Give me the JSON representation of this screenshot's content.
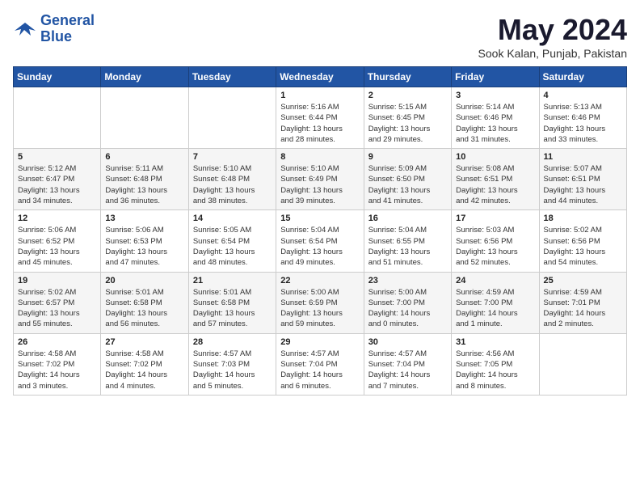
{
  "logo": {
    "line1": "General",
    "line2": "Blue"
  },
  "title": "May 2024",
  "location": "Sook Kalan, Punjab, Pakistan",
  "days_of_week": [
    "Sunday",
    "Monday",
    "Tuesday",
    "Wednesday",
    "Thursday",
    "Friday",
    "Saturday"
  ],
  "weeks": [
    [
      {
        "day": "",
        "content": ""
      },
      {
        "day": "",
        "content": ""
      },
      {
        "day": "",
        "content": ""
      },
      {
        "day": "1",
        "content": "Sunrise: 5:16 AM\nSunset: 6:44 PM\nDaylight: 13 hours\nand 28 minutes."
      },
      {
        "day": "2",
        "content": "Sunrise: 5:15 AM\nSunset: 6:45 PM\nDaylight: 13 hours\nand 29 minutes."
      },
      {
        "day": "3",
        "content": "Sunrise: 5:14 AM\nSunset: 6:46 PM\nDaylight: 13 hours\nand 31 minutes."
      },
      {
        "day": "4",
        "content": "Sunrise: 5:13 AM\nSunset: 6:46 PM\nDaylight: 13 hours\nand 33 minutes."
      }
    ],
    [
      {
        "day": "5",
        "content": "Sunrise: 5:12 AM\nSunset: 6:47 PM\nDaylight: 13 hours\nand 34 minutes."
      },
      {
        "day": "6",
        "content": "Sunrise: 5:11 AM\nSunset: 6:48 PM\nDaylight: 13 hours\nand 36 minutes."
      },
      {
        "day": "7",
        "content": "Sunrise: 5:10 AM\nSunset: 6:48 PM\nDaylight: 13 hours\nand 38 minutes."
      },
      {
        "day": "8",
        "content": "Sunrise: 5:10 AM\nSunset: 6:49 PM\nDaylight: 13 hours\nand 39 minutes."
      },
      {
        "day": "9",
        "content": "Sunrise: 5:09 AM\nSunset: 6:50 PM\nDaylight: 13 hours\nand 41 minutes."
      },
      {
        "day": "10",
        "content": "Sunrise: 5:08 AM\nSunset: 6:51 PM\nDaylight: 13 hours\nand 42 minutes."
      },
      {
        "day": "11",
        "content": "Sunrise: 5:07 AM\nSunset: 6:51 PM\nDaylight: 13 hours\nand 44 minutes."
      }
    ],
    [
      {
        "day": "12",
        "content": "Sunrise: 5:06 AM\nSunset: 6:52 PM\nDaylight: 13 hours\nand 45 minutes."
      },
      {
        "day": "13",
        "content": "Sunrise: 5:06 AM\nSunset: 6:53 PM\nDaylight: 13 hours\nand 47 minutes."
      },
      {
        "day": "14",
        "content": "Sunrise: 5:05 AM\nSunset: 6:54 PM\nDaylight: 13 hours\nand 48 minutes."
      },
      {
        "day": "15",
        "content": "Sunrise: 5:04 AM\nSunset: 6:54 PM\nDaylight: 13 hours\nand 49 minutes."
      },
      {
        "day": "16",
        "content": "Sunrise: 5:04 AM\nSunset: 6:55 PM\nDaylight: 13 hours\nand 51 minutes."
      },
      {
        "day": "17",
        "content": "Sunrise: 5:03 AM\nSunset: 6:56 PM\nDaylight: 13 hours\nand 52 minutes."
      },
      {
        "day": "18",
        "content": "Sunrise: 5:02 AM\nSunset: 6:56 PM\nDaylight: 13 hours\nand 54 minutes."
      }
    ],
    [
      {
        "day": "19",
        "content": "Sunrise: 5:02 AM\nSunset: 6:57 PM\nDaylight: 13 hours\nand 55 minutes."
      },
      {
        "day": "20",
        "content": "Sunrise: 5:01 AM\nSunset: 6:58 PM\nDaylight: 13 hours\nand 56 minutes."
      },
      {
        "day": "21",
        "content": "Sunrise: 5:01 AM\nSunset: 6:58 PM\nDaylight: 13 hours\nand 57 minutes."
      },
      {
        "day": "22",
        "content": "Sunrise: 5:00 AM\nSunset: 6:59 PM\nDaylight: 13 hours\nand 59 minutes."
      },
      {
        "day": "23",
        "content": "Sunrise: 5:00 AM\nSunset: 7:00 PM\nDaylight: 14 hours\nand 0 minutes."
      },
      {
        "day": "24",
        "content": "Sunrise: 4:59 AM\nSunset: 7:00 PM\nDaylight: 14 hours\nand 1 minute."
      },
      {
        "day": "25",
        "content": "Sunrise: 4:59 AM\nSunset: 7:01 PM\nDaylight: 14 hours\nand 2 minutes."
      }
    ],
    [
      {
        "day": "26",
        "content": "Sunrise: 4:58 AM\nSunset: 7:02 PM\nDaylight: 14 hours\nand 3 minutes."
      },
      {
        "day": "27",
        "content": "Sunrise: 4:58 AM\nSunset: 7:02 PM\nDaylight: 14 hours\nand 4 minutes."
      },
      {
        "day": "28",
        "content": "Sunrise: 4:57 AM\nSunset: 7:03 PM\nDaylight: 14 hours\nand 5 minutes."
      },
      {
        "day": "29",
        "content": "Sunrise: 4:57 AM\nSunset: 7:04 PM\nDaylight: 14 hours\nand 6 minutes."
      },
      {
        "day": "30",
        "content": "Sunrise: 4:57 AM\nSunset: 7:04 PM\nDaylight: 14 hours\nand 7 minutes."
      },
      {
        "day": "31",
        "content": "Sunrise: 4:56 AM\nSunset: 7:05 PM\nDaylight: 14 hours\nand 8 minutes."
      },
      {
        "day": "",
        "content": ""
      }
    ]
  ]
}
